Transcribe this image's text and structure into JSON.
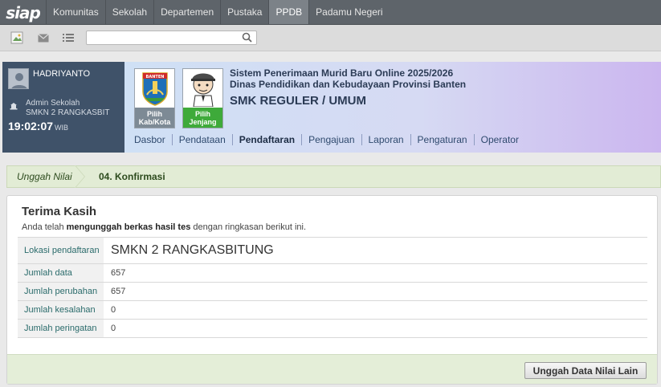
{
  "topnav": {
    "logo": "siap",
    "items": [
      "Komunitas",
      "Sekolah",
      "Departemen",
      "Pustaka",
      "PPDB",
      "Padamu Negeri"
    ],
    "active_index": 4
  },
  "toolbar": {
    "icons": [
      "image-icon",
      "mail-icon",
      "list-icon"
    ],
    "search_value": "",
    "search_placeholder": ""
  },
  "profile": {
    "name": "HADRIYANTO",
    "role": "Admin Sekolah",
    "school": "SMKN 2 RANGKASBIT",
    "time": "19:02:07",
    "tz": "WIB"
  },
  "banner": {
    "card1_label_line1": "Pilih",
    "card1_label_line2": "Kab/Kota",
    "card2_label_line1": "Pilih",
    "card2_label_line2": "Jenjang",
    "card1_color": "#7d8a95",
    "card2_color": "#3eaa3a",
    "title_line1": "Sistem Penerimaan Murid Baru Online 2025/2026",
    "title_line2": "Dinas Pendidikan dan Kebudayaan Provinsi Banten",
    "title_main": "SMK REGULER / UMUM",
    "emblem_text": "BANTEN"
  },
  "subnav": {
    "items": [
      "Dasbor",
      "Pendataan",
      "Pendaftaran",
      "Pengajuan",
      "Laporan",
      "Pengaturan",
      "Operator"
    ],
    "active_index": 2
  },
  "breadcrumb": {
    "step1": "Unggah Nilai",
    "step2": "04. Konfirmasi"
  },
  "confirm": {
    "title": "Terima Kasih",
    "sub_pre": "Anda telah ",
    "sub_bold": "mengunggah berkas hasil tes",
    "sub_post": " dengan ringkasan berikut ini.",
    "rows": [
      {
        "label": "Lokasi pendaftaran",
        "value": "SMKN 2 RANGKASBITUNG"
      },
      {
        "label": "Jumlah data",
        "value": "657"
      },
      {
        "label": "Jumlah perubahan",
        "value": "657"
      },
      {
        "label": "Jumlah kesalahan",
        "value": "0"
      },
      {
        "label": "Jumlah peringatan",
        "value": "0"
      }
    ],
    "button_label": "Unggah Data Nilai Lain"
  }
}
